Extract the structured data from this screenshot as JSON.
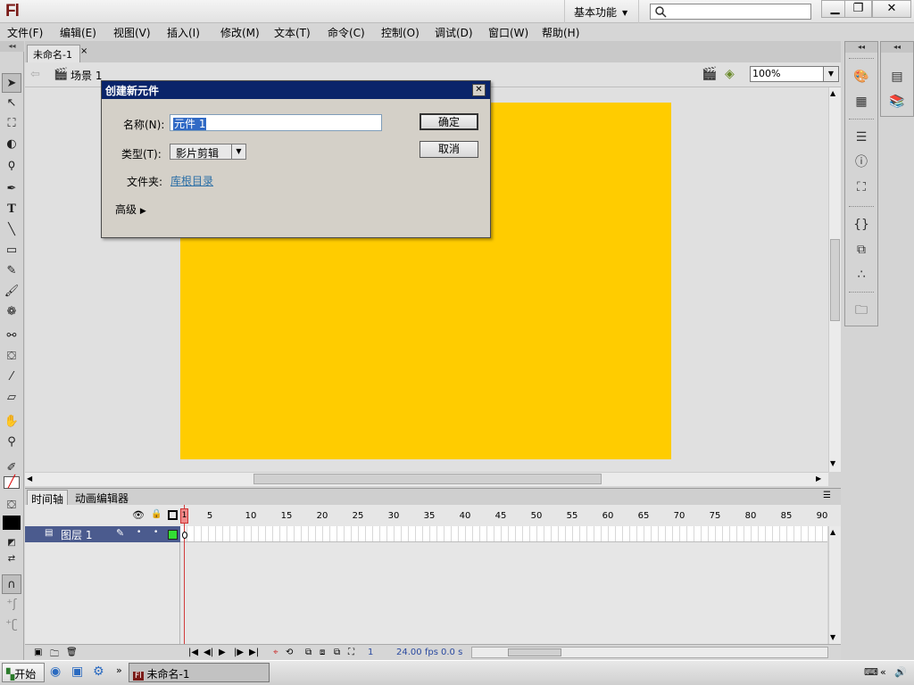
{
  "app": {
    "logo": "Fl",
    "workspace": "基本功能"
  },
  "search": {
    "placeholder": ""
  },
  "menu": [
    "文件(F)",
    "编辑(E)",
    "视图(V)",
    "插入(I)",
    "修改(M)",
    "文本(T)",
    "命令(C)",
    "控制(O)",
    "调试(D)",
    "窗口(W)",
    "帮助(H)"
  ],
  "document": {
    "tab": "未命名-1",
    "scene": "场景 1",
    "zoom": "100%",
    "stage_color": "#ffcc00"
  },
  "dialog": {
    "title": "创建新元件",
    "name_label": "名称(N):",
    "name_value": "元件 1",
    "type_label": "类型(T):",
    "type_value": "影片剪辑",
    "folder_label": "文件夹:",
    "folder_value": "库根目录",
    "advanced": "高级",
    "ok": "确定",
    "cancel": "取消"
  },
  "timeline": {
    "tabs": [
      "时间轴",
      "动画编辑器"
    ],
    "frame_numbers": [
      "1",
      "5",
      "10",
      "15",
      "20",
      "25",
      "30",
      "35",
      "40",
      "45",
      "50",
      "55",
      "60",
      "65",
      "70",
      "75",
      "80",
      "85",
      "90"
    ],
    "layer_name": "图层 1",
    "current_frame": "1",
    "fps": "24.00",
    "fps_unit": "fps",
    "time": "0.0",
    "time_unit": "s"
  },
  "taskbar": {
    "start": "开始",
    "task": "未命名-1"
  }
}
